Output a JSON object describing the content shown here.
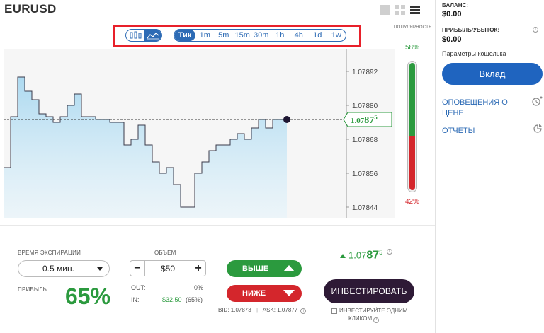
{
  "header": {
    "symbol": "EURUSD",
    "view_icons": [
      "single-view-icon",
      "grid-view-icon",
      "menu-icon"
    ]
  },
  "toolbar": {
    "chart_types": [
      {
        "icon": "candlestick-icon",
        "active": false
      },
      {
        "icon": "line-chart-icon",
        "active": true
      }
    ],
    "timeframes": [
      "Тик",
      "1m",
      "5m",
      "15m",
      "30m",
      "1h",
      "4h",
      "1d",
      "1w"
    ],
    "active_timeframe": "Тик"
  },
  "chart": {
    "y_ticks": [
      "1.07892",
      "1.07880",
      "1.07868",
      "1.07856",
      "1.07844"
    ],
    "current_price_main": "1.07",
    "current_price_big": "87",
    "current_price_sup": "5"
  },
  "chart_data": {
    "type": "area",
    "ylim": [
      1.0784,
      1.079
    ],
    "series": [
      {
        "values": [
          1.07858,
          1.07876,
          1.0789,
          1.07885,
          1.07882,
          1.07877,
          1.07876,
          1.07874,
          1.07876,
          1.0788,
          1.07884,
          1.07876,
          1.07876,
          1.07875,
          1.07875,
          1.07874,
          1.07874,
          1.07866,
          1.07868,
          1.07873,
          1.07866,
          1.0786,
          1.07856,
          1.07858,
          1.07852,
          1.07844,
          1.07844,
          1.07856,
          1.0786,
          1.07864,
          1.07866,
          1.07866,
          1.07868,
          1.0787,
          1.07868,
          1.07872,
          1.07875,
          1.07872,
          1.07875,
          1.07875,
          1.07875
        ]
      }
    ]
  },
  "popularity": {
    "label": "ПОПУЛЯРНОСТЬ",
    "up_pct": "58%",
    "down_pct": "42%",
    "up_fraction": 0.58
  },
  "sidebar": {
    "balance_label": "БАЛАНС:",
    "balance_value": "$0.00",
    "pnl_label": "ПРИБЫЛЬ/УБЫТОК:",
    "pnl_value": "$0.00",
    "wallet_link": "Параметры кошелька",
    "deposit": "Вклад",
    "alerts_line1": "ОПОВЕЩЕНИЯ О",
    "alerts_line2": "ЦЕНЕ",
    "reports": "ОТЧЕТЫ"
  },
  "trade": {
    "expiry_label": "ВРЕМЯ ЭКСПИРАЦИИ",
    "expiry_value": "0.5 мин.",
    "profit_label": "ПРИБЫЛЬ",
    "profit_value": "65%",
    "volume_label": "ОБЪЕМ",
    "amount": "$50",
    "minus": "−",
    "plus": "+",
    "out_label": "OUT:",
    "out_value": "0%",
    "in_label": "IN:",
    "in_value": "$32.50",
    "in_pct": "(65%)",
    "up_label": "ВЫШЕ",
    "down_label": "НИЖЕ",
    "bid": "BID: 1.07873",
    "ask": "ASK: 1.07877",
    "price_main": "1.07",
    "price_big": "87",
    "price_sup": "5",
    "invest": "ИНВЕСТИРОВАТЬ",
    "one_click_line1": "ИНВЕСТИРУЙТЕ ОДНИМ",
    "one_click_line2": "КЛИКОМ",
    "accent_green": "#2b9a3e",
    "accent_red": "#d4262c",
    "brand_blue": "#1f64bf"
  }
}
